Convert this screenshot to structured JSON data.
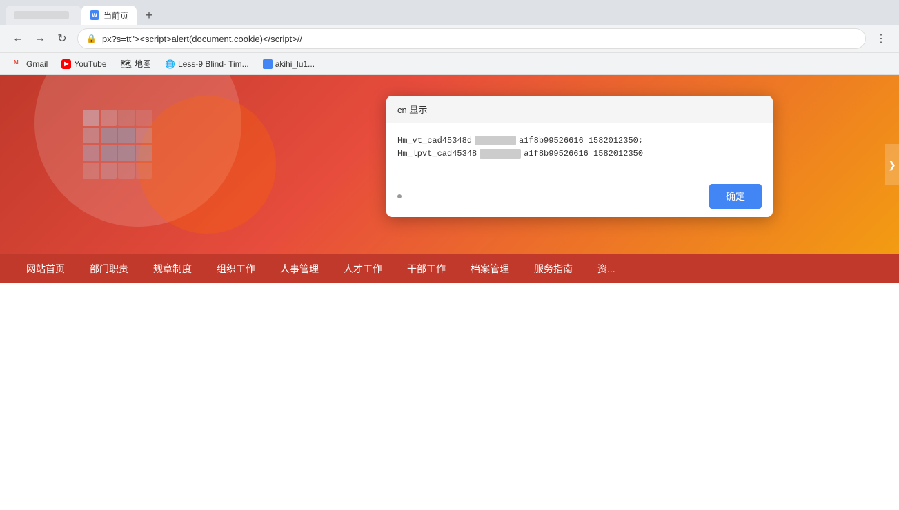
{
  "browser": {
    "address_bar": {
      "url": "px?s=tt\"><script>alert(document.cookie)</script>//",
      "lock_icon": "🔒"
    },
    "tabs": [
      {
        "id": "tab-1",
        "label": "",
        "favicon_type": "redacted",
        "active": false
      },
      {
        "id": "tab-2",
        "label": "当前页",
        "favicon_type": "blue",
        "active": true
      }
    ],
    "bookmarks": [
      {
        "label": "Gmail",
        "favicon_type": "gmail"
      },
      {
        "label": "YouTube",
        "favicon_type": "youtube"
      },
      {
        "label": "地图",
        "favicon_type": "maps"
      },
      {
        "label": "Less-9 Blind- Tim...",
        "favicon_type": "globe"
      },
      {
        "label": "akihi_lu1...",
        "favicon_type": "blue-tab"
      }
    ]
  },
  "site": {
    "nav_items": [
      "网站首页",
      "部门职责",
      "规章制度",
      "组织工作",
      "人事管理",
      "人才工作",
      "干部工作",
      "档案管理",
      "服务指南",
      "资..."
    ]
  },
  "alert_dialog": {
    "title_prefix": "",
    "domain": "cn 显示",
    "cookie_line1": "Hm_vt_cad45348d",
    "cookie_line1_mid": "",
    "cookie_line1_end": "a1f8b99526616=1582012350;",
    "cookie_line2": "Hm_lpvt_cad45348",
    "cookie_line2_mid": "",
    "cookie_line2_end": "a1f8b99526616=1582012350",
    "confirm_label": "确定"
  },
  "icons": {
    "lock": "🔒",
    "back": "←",
    "forward": "→",
    "refresh": "↻",
    "menu": "⋮"
  }
}
